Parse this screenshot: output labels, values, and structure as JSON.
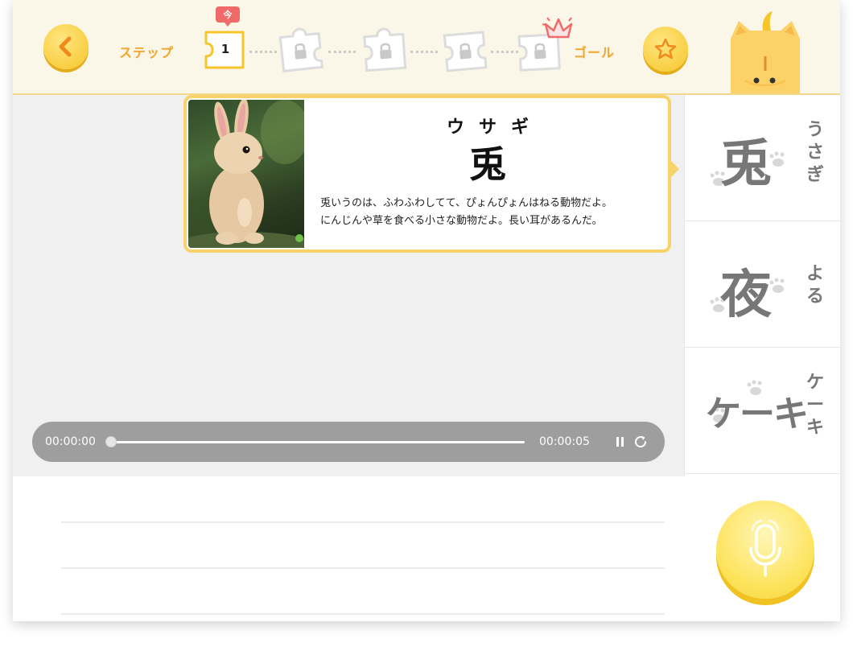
{
  "header": {
    "step_label": "ステップ",
    "goal_label": "ゴール",
    "current_badge": "今",
    "current_step": "1",
    "total_pieces": 5,
    "locked_pieces": 4
  },
  "word_card": {
    "reading": "ウサギ",
    "kanji": "兎",
    "description_line1": "兎いうのは、ふわふわしてて、ぴょんぴょんはねる動物だよ。",
    "description_line2": "にんじんや草を食べる小さな動物だよ。長い耳があるんだ。"
  },
  "audio": {
    "current_time": "00:00:00",
    "total_time": "00:00:05",
    "progress": 0.0
  },
  "word_list": [
    {
      "main": "兎",
      "kana": "うさぎ"
    },
    {
      "main": "夜",
      "kana": "よる"
    },
    {
      "main": "ケーキ",
      "kana": "ケーキ"
    }
  ],
  "colors": {
    "accent_yellow": "#f6c52a",
    "header_bg": "#faf6e8",
    "step_text": "#f0a628",
    "badge_red": "#f06a6a",
    "card_border": "#f8d26a"
  },
  "icons": {
    "back": "chevron-left-icon",
    "star": "star-icon",
    "lock": "lock-icon",
    "crown": "crown-icon",
    "pause": "pause-icon",
    "replay": "replay-icon",
    "mic": "microphone-icon",
    "paw": "paw-print-icon"
  }
}
